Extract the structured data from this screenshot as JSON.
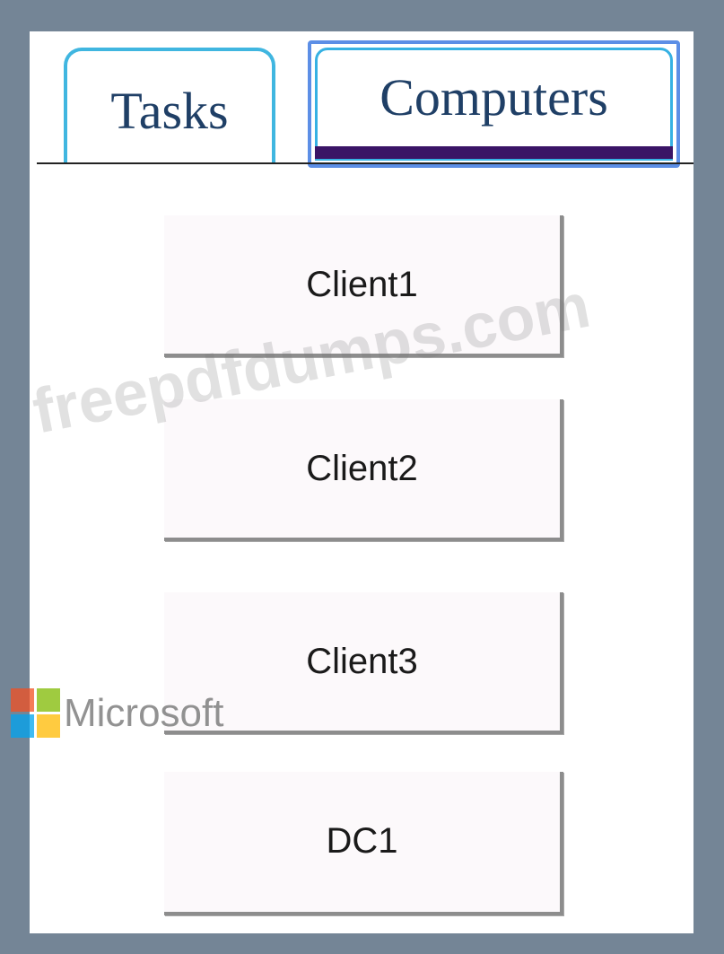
{
  "tabs": [
    {
      "label": "Tasks",
      "selected": false
    },
    {
      "label": "Computers",
      "selected": true
    }
  ],
  "computers": [
    {
      "label": "Client1"
    },
    {
      "label": "Client2"
    },
    {
      "label": "Client3"
    },
    {
      "label": "DC1"
    }
  ],
  "watermark": {
    "text": "freepdfdumps.com"
  },
  "logo": {
    "text": "Microsoft",
    "colors": [
      "#f25022",
      "#7fba00",
      "#00a4ef",
      "#ffb900"
    ]
  },
  "colors": {
    "frame": "#748596",
    "tab_text": "#1f3f66",
    "selected_tab_bar": "#3a1466",
    "tab_border": "#40b6e0"
  }
}
